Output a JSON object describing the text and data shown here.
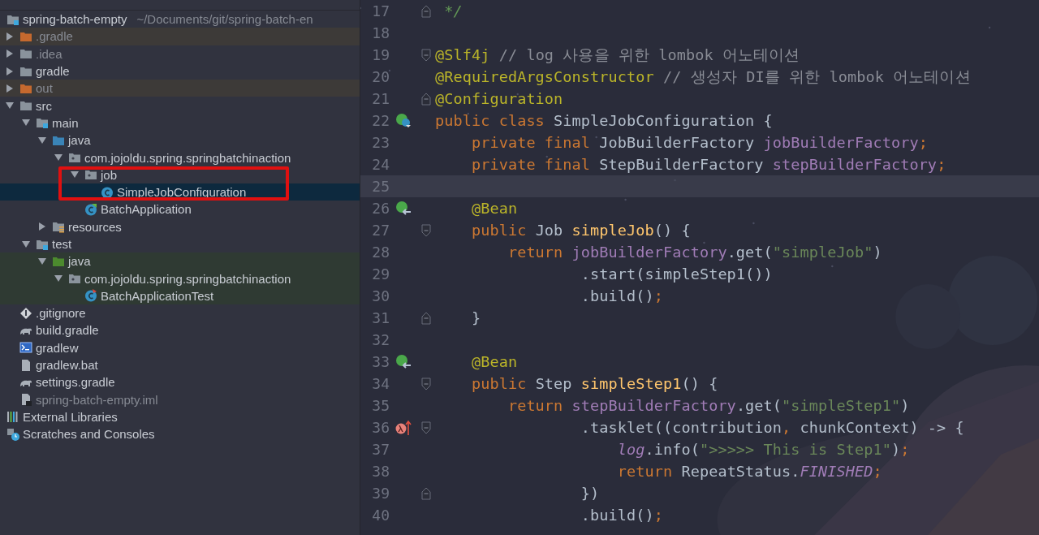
{
  "project_tree": {
    "nodes": [
      {
        "label": "spring-batch-empty",
        "path": "~/Documents/git/spring-batch-en",
        "kind": "module",
        "children": [
          {
            "label": ".gradle",
            "kind": "excluded-folder",
            "dimmed": true,
            "expanded": false
          },
          {
            "label": ".idea",
            "kind": "folder",
            "dimmed": true,
            "expanded": false
          },
          {
            "label": "gradle",
            "kind": "folder",
            "dimmed": false,
            "expanded": false
          },
          {
            "label": "out",
            "kind": "excluded-folder",
            "dimmed": true,
            "expanded": false
          },
          {
            "label": "src",
            "kind": "folder",
            "dimmed": false,
            "expanded": true,
            "children": [
              {
                "label": "main",
                "kind": "module-folder",
                "dimmed": false,
                "expanded": true,
                "children": [
                  {
                    "label": "java",
                    "kind": "source-folder",
                    "dimmed": false,
                    "expanded": true,
                    "children": [
                      {
                        "label": "com.jojoldu.spring.springbatchinaction",
                        "kind": "package",
                        "dimmed": false,
                        "expanded": true,
                        "children": [
                          {
                            "label": "job",
                            "kind": "package",
                            "dimmed": false,
                            "expanded": true,
                            "children": [
                              {
                                "label": "SimpleJobConfiguration",
                                "kind": "class",
                                "dimmed": false,
                                "selected": true
                              }
                            ]
                          },
                          {
                            "label": "BatchApplication",
                            "kind": "app-class",
                            "dimmed": false,
                            "selected": false
                          }
                        ]
                      }
                    ]
                  },
                  {
                    "label": "resources",
                    "kind": "resources-folder",
                    "dimmed": false,
                    "expanded": false
                  }
                ]
              },
              {
                "label": "test",
                "kind": "module-folder",
                "dimmed": false,
                "expanded": true,
                "children": [
                  {
                    "label": "java",
                    "kind": "test-source-folder",
                    "dimmed": false,
                    "expanded": true,
                    "children": [
                      {
                        "label": "com.jojoldu.spring.springbatchinaction",
                        "kind": "package",
                        "dimmed": false,
                        "expanded": true,
                        "children": [
                          {
                            "label": "BatchApplicationTest",
                            "kind": "test-class",
                            "dimmed": false,
                            "selected": false
                          }
                        ]
                      }
                    ]
                  }
                ]
              }
            ]
          },
          {
            "label": ".gitignore",
            "kind": "gitignore",
            "dimmed": false
          },
          {
            "label": "build.gradle",
            "kind": "gradle",
            "dimmed": false
          },
          {
            "label": "gradlew",
            "kind": "terminal",
            "dimmed": false
          },
          {
            "label": "gradlew.bat",
            "kind": "file",
            "dimmed": false
          },
          {
            "label": "settings.gradle",
            "kind": "gradle",
            "dimmed": false
          },
          {
            "label": "spring-batch-empty.iml",
            "kind": "iml",
            "dimmed": true
          }
        ]
      },
      {
        "label": "External Libraries",
        "kind": "libraries",
        "dimmed": false
      },
      {
        "label": "Scratches and Consoles",
        "kind": "scratches",
        "dimmed": false
      }
    ]
  },
  "editor": {
    "lines": [
      {
        "number": "17",
        "fold_marker": {
          "kind": "end"
        },
        "tokens": [
          {
            "kind": "doc",
            "text": " */"
          }
        ]
      },
      {
        "number": "18"
      },
      {
        "number": "19",
        "fold_marker": {
          "kind": "start"
        },
        "tokens": [
          {
            "kind": "ann",
            "text": "@Slf4j"
          },
          {
            "kind": "cmt",
            "text": " // log 사용을 위한 lombok 어노테이션"
          }
        ]
      },
      {
        "number": "20",
        "tokens": [
          {
            "kind": "ann",
            "text": "@RequiredArgsConstructor"
          },
          {
            "kind": "cmt",
            "text": " // 생성자 DI를 위한 lombok 어노테이션"
          }
        ]
      },
      {
        "number": "21",
        "fold_marker": {
          "kind": "end"
        },
        "tokens": [
          {
            "kind": "ann",
            "text": "@Configuration"
          }
        ]
      },
      {
        "number": "22",
        "gutter_icon": {
          "kind": "class"
        },
        "tokens": [
          {
            "kind": "kw",
            "text": "public class "
          },
          {
            "kind": "plain",
            "text": "SimpleJobConfiguration {"
          }
        ]
      },
      {
        "number": "23",
        "tokens": [
          {
            "kind": "kw",
            "text": "    private final "
          },
          {
            "kind": "plain",
            "text": "JobBuilderFactory "
          },
          {
            "kind": "field",
            "text": "jobBuilderFactory"
          },
          {
            "kind": "punct",
            "text": ";"
          }
        ]
      },
      {
        "number": "24",
        "tokens": [
          {
            "kind": "kw",
            "text": "    private final "
          },
          {
            "kind": "plain",
            "text": "StepBuilderFactory "
          },
          {
            "kind": "field",
            "text": "stepBuilderFactory"
          },
          {
            "kind": "punct",
            "text": ";"
          }
        ]
      },
      {
        "number": "25",
        "current": true
      },
      {
        "number": "26",
        "gutter_icon": {
          "kind": "bean"
        },
        "tokens": [
          {
            "kind": "ann",
            "text": "    @Bean"
          }
        ]
      },
      {
        "number": "27",
        "fold_marker": {
          "kind": "start"
        },
        "tokens": [
          {
            "kind": "kw",
            "text": "    public "
          },
          {
            "kind": "plain",
            "text": "Job "
          },
          {
            "kind": "fn",
            "text": "simpleJob"
          },
          {
            "kind": "plain",
            "text": "() {"
          }
        ]
      },
      {
        "number": "28",
        "tokens": [
          {
            "kind": "kw",
            "text": "        return "
          },
          {
            "kind": "field",
            "text": "jobBuilderFactory"
          },
          {
            "kind": "plain",
            "text": ".get("
          },
          {
            "kind": "str",
            "text": "\"simpleJob\""
          },
          {
            "kind": "plain",
            "text": ")"
          }
        ]
      },
      {
        "number": "29",
        "tokens": [
          {
            "kind": "plain",
            "text": "                .start(simpleStep1())"
          }
        ]
      },
      {
        "number": "30",
        "tokens": [
          {
            "kind": "plain",
            "text": "                .build()"
          },
          {
            "kind": "punct",
            "text": ";"
          }
        ]
      },
      {
        "number": "31",
        "fold_marker": {
          "kind": "end"
        },
        "tokens": [
          {
            "kind": "plain",
            "text": "    }"
          }
        ]
      },
      {
        "number": "32"
      },
      {
        "number": "33",
        "gutter_icon": {
          "kind": "bean"
        },
        "tokens": [
          {
            "kind": "ann",
            "text": "    @Bean"
          }
        ]
      },
      {
        "number": "34",
        "fold_marker": {
          "kind": "start"
        },
        "tokens": [
          {
            "kind": "kw",
            "text": "    public "
          },
          {
            "kind": "plain",
            "text": "Step "
          },
          {
            "kind": "fn",
            "text": "simpleStep1"
          },
          {
            "kind": "plain",
            "text": "() {"
          }
        ]
      },
      {
        "number": "35",
        "tokens": [
          {
            "kind": "kw",
            "text": "        return "
          },
          {
            "kind": "field",
            "text": "stepBuilderFactory"
          },
          {
            "kind": "plain",
            "text": ".get("
          },
          {
            "kind": "str",
            "text": "\"simpleStep1\""
          },
          {
            "kind": "plain",
            "text": ")"
          }
        ]
      },
      {
        "number": "36",
        "gutter_icon": {
          "kind": "lambda"
        },
        "fold_marker": {
          "kind": "start"
        },
        "tokens": [
          {
            "kind": "plain",
            "text": "                .tasklet((contribution"
          },
          {
            "kind": "punct",
            "text": ", "
          },
          {
            "kind": "plain",
            "text": "chunkContext) -> {"
          }
        ]
      },
      {
        "number": "37",
        "tokens": [
          {
            "kind": "static",
            "text": "                    log"
          },
          {
            "kind": "plain",
            "text": ".info("
          },
          {
            "kind": "str",
            "text": "\">>>>> This is Step1\""
          },
          {
            "kind": "plain",
            "text": ")"
          },
          {
            "kind": "punct",
            "text": ";"
          }
        ]
      },
      {
        "number": "38",
        "tokens": [
          {
            "kind": "kw",
            "text": "                    return "
          },
          {
            "kind": "plain",
            "text": "RepeatStatus."
          },
          {
            "kind": "static",
            "text": "FINISHED"
          },
          {
            "kind": "punct",
            "text": ";"
          }
        ]
      },
      {
        "number": "39",
        "fold_marker": {
          "kind": "end"
        },
        "tokens": [
          {
            "kind": "plain",
            "text": "                })"
          }
        ]
      },
      {
        "number": "40",
        "tokens": [
          {
            "kind": "plain",
            "text": "                .build()"
          },
          {
            "kind": "punct",
            "text": ";"
          }
        ]
      }
    ]
  }
}
